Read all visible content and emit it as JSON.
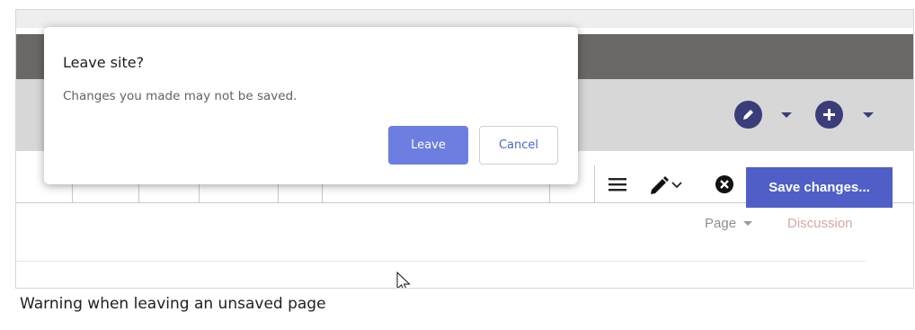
{
  "dialog": {
    "title": "Leave site?",
    "message": "Changes you made may not be saved.",
    "leave_label": "Leave",
    "cancel_label": "Cancel"
  },
  "header_actions": [
    {
      "icon": "pencil-icon",
      "dropdown": true
    },
    {
      "icon": "plus-icon",
      "dropdown": true
    }
  ],
  "toolbar": {
    "save_label": "Save changes...",
    "icons": [
      "hamburger-menu-icon",
      "pencil-icon",
      "chevron-down-icon",
      "close-circle-icon"
    ]
  },
  "tabs": {
    "page_label": "Page",
    "discussion_label": "Discussion"
  },
  "caption": "Warning when leaving an unsaved page",
  "colors": {
    "accent": "#4f5fc7",
    "leave_button": "#6c7fe0",
    "header_dark": "#6b6764",
    "header_gray": "#d7d7d7",
    "circle_button": "#3a3d7a"
  }
}
